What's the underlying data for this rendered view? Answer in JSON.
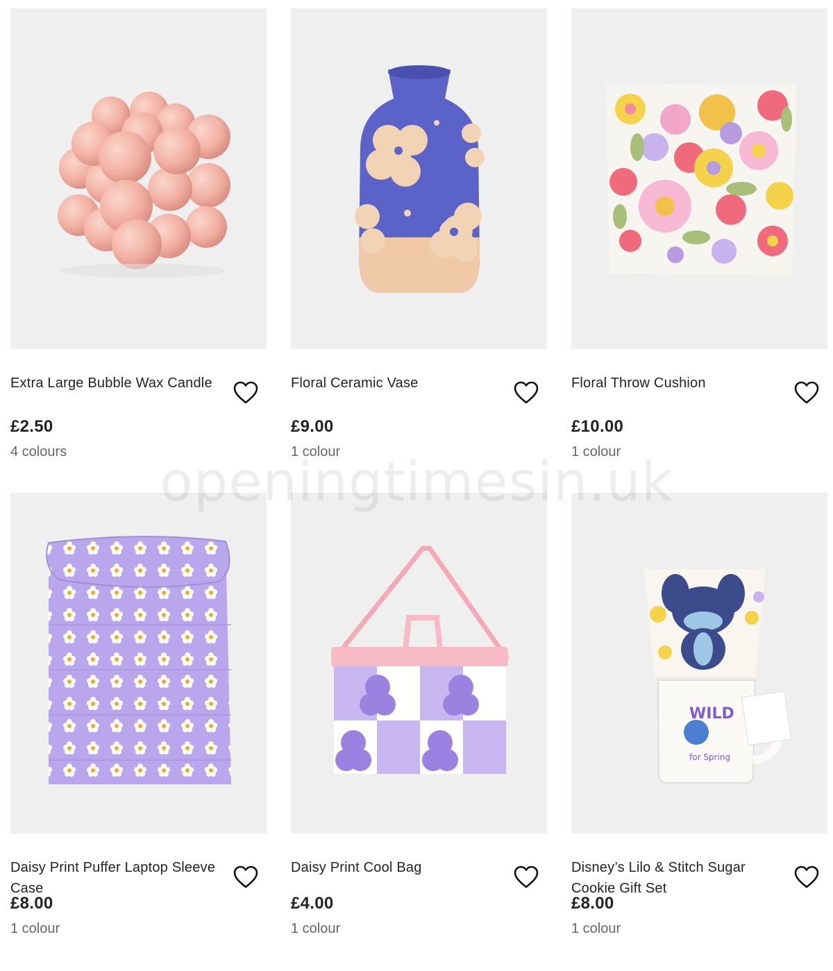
{
  "products": [
    {
      "title": "Extra Large Bubble Wax Candle",
      "price": "£2.50",
      "colours": "4 colours",
      "image": "bubble-candle-image"
    },
    {
      "title": "Floral Ceramic Vase",
      "price": "£9.00",
      "colours": "1 colour",
      "image": "floral-vase-image"
    },
    {
      "title": "Floral Throw Cushion",
      "price": "£10.00",
      "colours": "1 colour",
      "image": "floral-cushion-image"
    },
    {
      "title": "Daisy Print Puffer Laptop Sleeve Case",
      "price": "£8.00",
      "colours": "1 colour",
      "image": "laptop-sleeve-image"
    },
    {
      "title": "Daisy Print Cool Bag",
      "price": "£4.00",
      "colours": "1 colour",
      "image": "cool-bag-image"
    },
    {
      "title": "Disney’s Lilo & Stitch Sugar Cookie Gift Set",
      "price": "£8.00",
      "colours": "1 colour",
      "image": "stitch-gift-set-image"
    }
  ],
  "watermark": "openingtimesin.uk",
  "colors": {
    "card_bg": "#efefef",
    "price": "#222222",
    "muted": "#666666",
    "heart_stroke": "#111111"
  }
}
